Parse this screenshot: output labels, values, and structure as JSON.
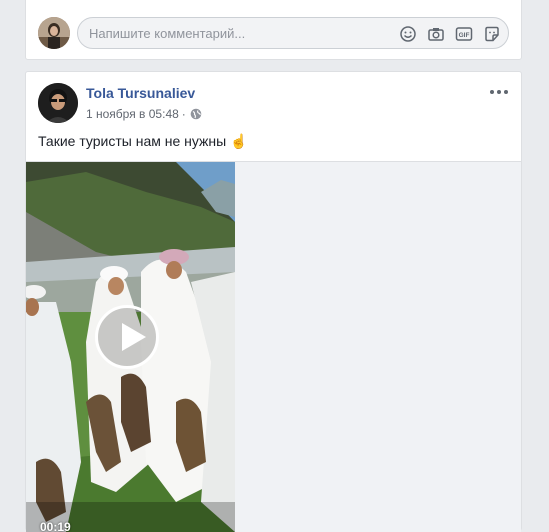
{
  "composer": {
    "placeholder": "Напишите комментарий...",
    "icons": [
      "emoji-icon",
      "camera-icon",
      "gif-icon",
      "sticker-icon"
    ]
  },
  "post": {
    "author": "Tola Tursunaliev",
    "timestamp": "1 ноября в 05:48",
    "separator": "·",
    "privacy_icon": "globe-icon",
    "text": "Такие туристы нам не нужны ☝",
    "video": {
      "duration": "00:19"
    }
  },
  "colors": {
    "link": "#385898",
    "background": "#e9ebee",
    "meta_text": "#616770"
  }
}
